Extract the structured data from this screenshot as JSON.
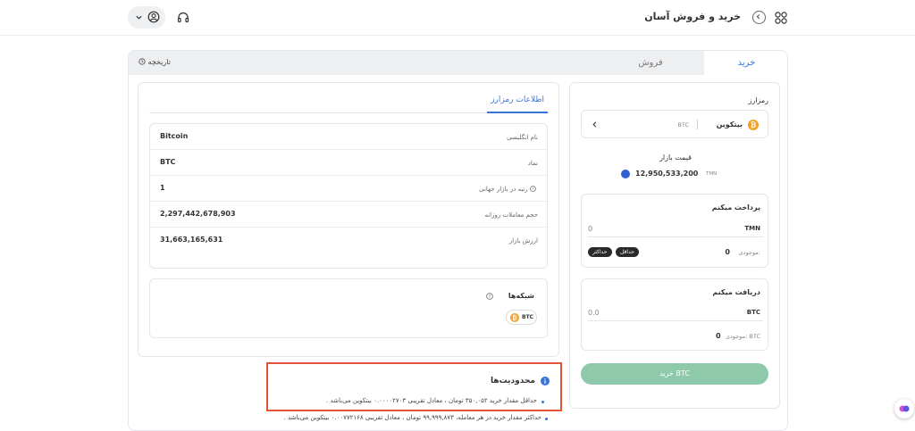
{
  "header": {
    "title": "خرید و فروش آسان"
  },
  "tabs": {
    "buy": "خرید",
    "sell": "فروش",
    "history": "تاریخچه"
  },
  "trade": {
    "crypto_label": "رمزارز",
    "coin_name": "بیتکوین",
    "coin_symbol": "BTC",
    "market_price_label": "قیمت بازار",
    "market_price_value": "12,950,533,200",
    "market_price_unit": "TMN",
    "pay_label": "پرداخت میکنم",
    "pay_amount": "0",
    "pay_currency": "TMN",
    "balance_label": "موجودی:",
    "pay_balance": "0",
    "min_badge": "حداقل",
    "max_badge": "حداکثر",
    "receive_label": "دریافت میکنم",
    "receive_amount": "0.0",
    "receive_currency": "BTC",
    "receive_balance_label": "موجودی: BTC",
    "receive_balance": "0",
    "buy_button": "خرید BTC"
  },
  "info": {
    "tab_label": "اطلاعات رمزارز",
    "rows": [
      {
        "key": "نام انگلیسی",
        "value": "Bitcoin"
      },
      {
        "key": "نماد",
        "value": "BTC"
      },
      {
        "key": "رتبه در بازار جهانی",
        "value": "1"
      },
      {
        "key": "حجم معاملات روزانه",
        "value": "2,297,442,678,903"
      },
      {
        "key": "ارزش بازار",
        "value": "31,663,165,631"
      }
    ],
    "networks_label": "شبکه‌ها",
    "network_chip": "BTC"
  },
  "limits": {
    "title": "محدودیت‌ها",
    "items": [
      "حداقل مقدار خرید ۳۵۰,۰۵۲ تومان ، معادل تقریبی ۰.۰۰۰۰۲۷۰۳ بیتکوین می‌باشد .",
      "حداکثر مقدار خرید در هر معامله، ۹۹,۹۹۹,۸۷۳ تومان ، معادل تقریبی ۰.۰۰۷۷۲۱۶۸ بیتکوین می‌باشد ."
    ]
  },
  "colors": {
    "accent": "#3a74d9",
    "bitcoin": "#f0a02d",
    "buy_button": "#8fc9ab",
    "highlight": "#e05435"
  }
}
